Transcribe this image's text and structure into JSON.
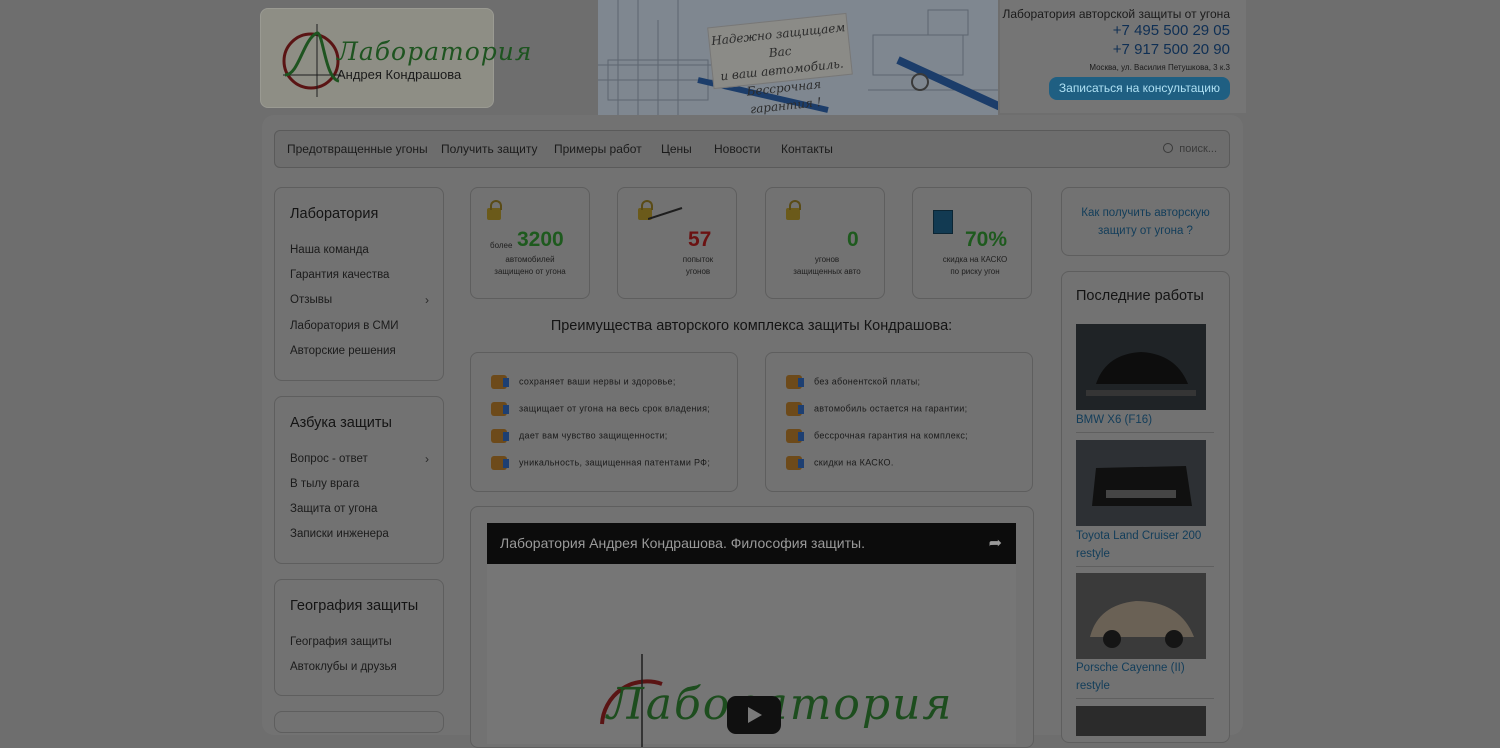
{
  "header": {
    "logo_title": "Лаборатория",
    "logo_subtitle": "Андрея Кондрашова",
    "banner_note_1": "Надежно защищаем Вас",
    "banner_note_2": "и ваш автомобиль.",
    "banner_note_3": "Бессрочная гарантия !",
    "contact_title": "Лаборатория авторской защиты от угона",
    "phone_1": "+7 495 500 29 05",
    "phone_2": "+7 917 500 20 90",
    "address": "Москва, ул. Василия Петушкова, 3 к.3",
    "consult_button": "Записаться на консультацию"
  },
  "nav": {
    "items": [
      "Предотвращенные угоны",
      "Получить защиту",
      "Примеры работ",
      "Цены",
      "Новости",
      "Контакты"
    ],
    "search_placeholder": "поиск..."
  },
  "sidebar": {
    "boxes": [
      {
        "title": "Лаборатория",
        "links": [
          "Наша команда",
          "Гарантия качества",
          "Отзывы",
          "Лаборатория в СМИ",
          "Авторские решения"
        ]
      },
      {
        "title": "Азбука защиты",
        "links": [
          "Вопрос - ответ",
          "В тылу врага",
          "Защита от угона",
          "Записки инженера"
        ]
      },
      {
        "title": "География защиты",
        "links": [
          "География защиты",
          "Автоклубы и друзья"
        ]
      }
    ],
    "chevron": "›"
  },
  "stats": [
    {
      "prefix": "более",
      "value": "3200",
      "label_1": "автомобилей",
      "label_2": "защищено от угона",
      "color": "#1e5a1e"
    },
    {
      "prefix": "",
      "value": "57",
      "label_1": "попыток",
      "label_2": "угонов",
      "color": "#6b1212"
    },
    {
      "prefix": "",
      "value": "0",
      "label_1": "угонов",
      "label_2": "защищенных авто",
      "color": "#1e5a1e"
    },
    {
      "prefix": "",
      "value": "70%",
      "label_1": "скидка на КАСКО",
      "label_2": "по риску угон",
      "color": "#1e5a1e"
    }
  ],
  "advantages": {
    "title": "Преимущества авторского комплекса защиты Кондрашова:",
    "left": [
      "сохраняет ваши нервы и здоровье;",
      "защищает от угона на весь срок владения;",
      "дает вам чувство защищенности;",
      "уникальность, защищенная патентами РФ;"
    ],
    "right": [
      "без абонентской платы;",
      "автомобиль остается на гарантии;",
      "бессрочная гарантия на комплекс;",
      "скидки на КАСКО."
    ]
  },
  "video": {
    "title": "Лаборатория Андрея Кондрашова. Философия защиты.",
    "logo_text": "Лаборатория"
  },
  "right": {
    "consult_link": "Как получить авторскую защиту от угона ?",
    "recent_title": "Последние работы",
    "works": [
      "BMW X6 (F16)",
      "Toyota Land Cruiser 200 restyle",
      "Porsche Cayenne (II) restyle"
    ]
  }
}
